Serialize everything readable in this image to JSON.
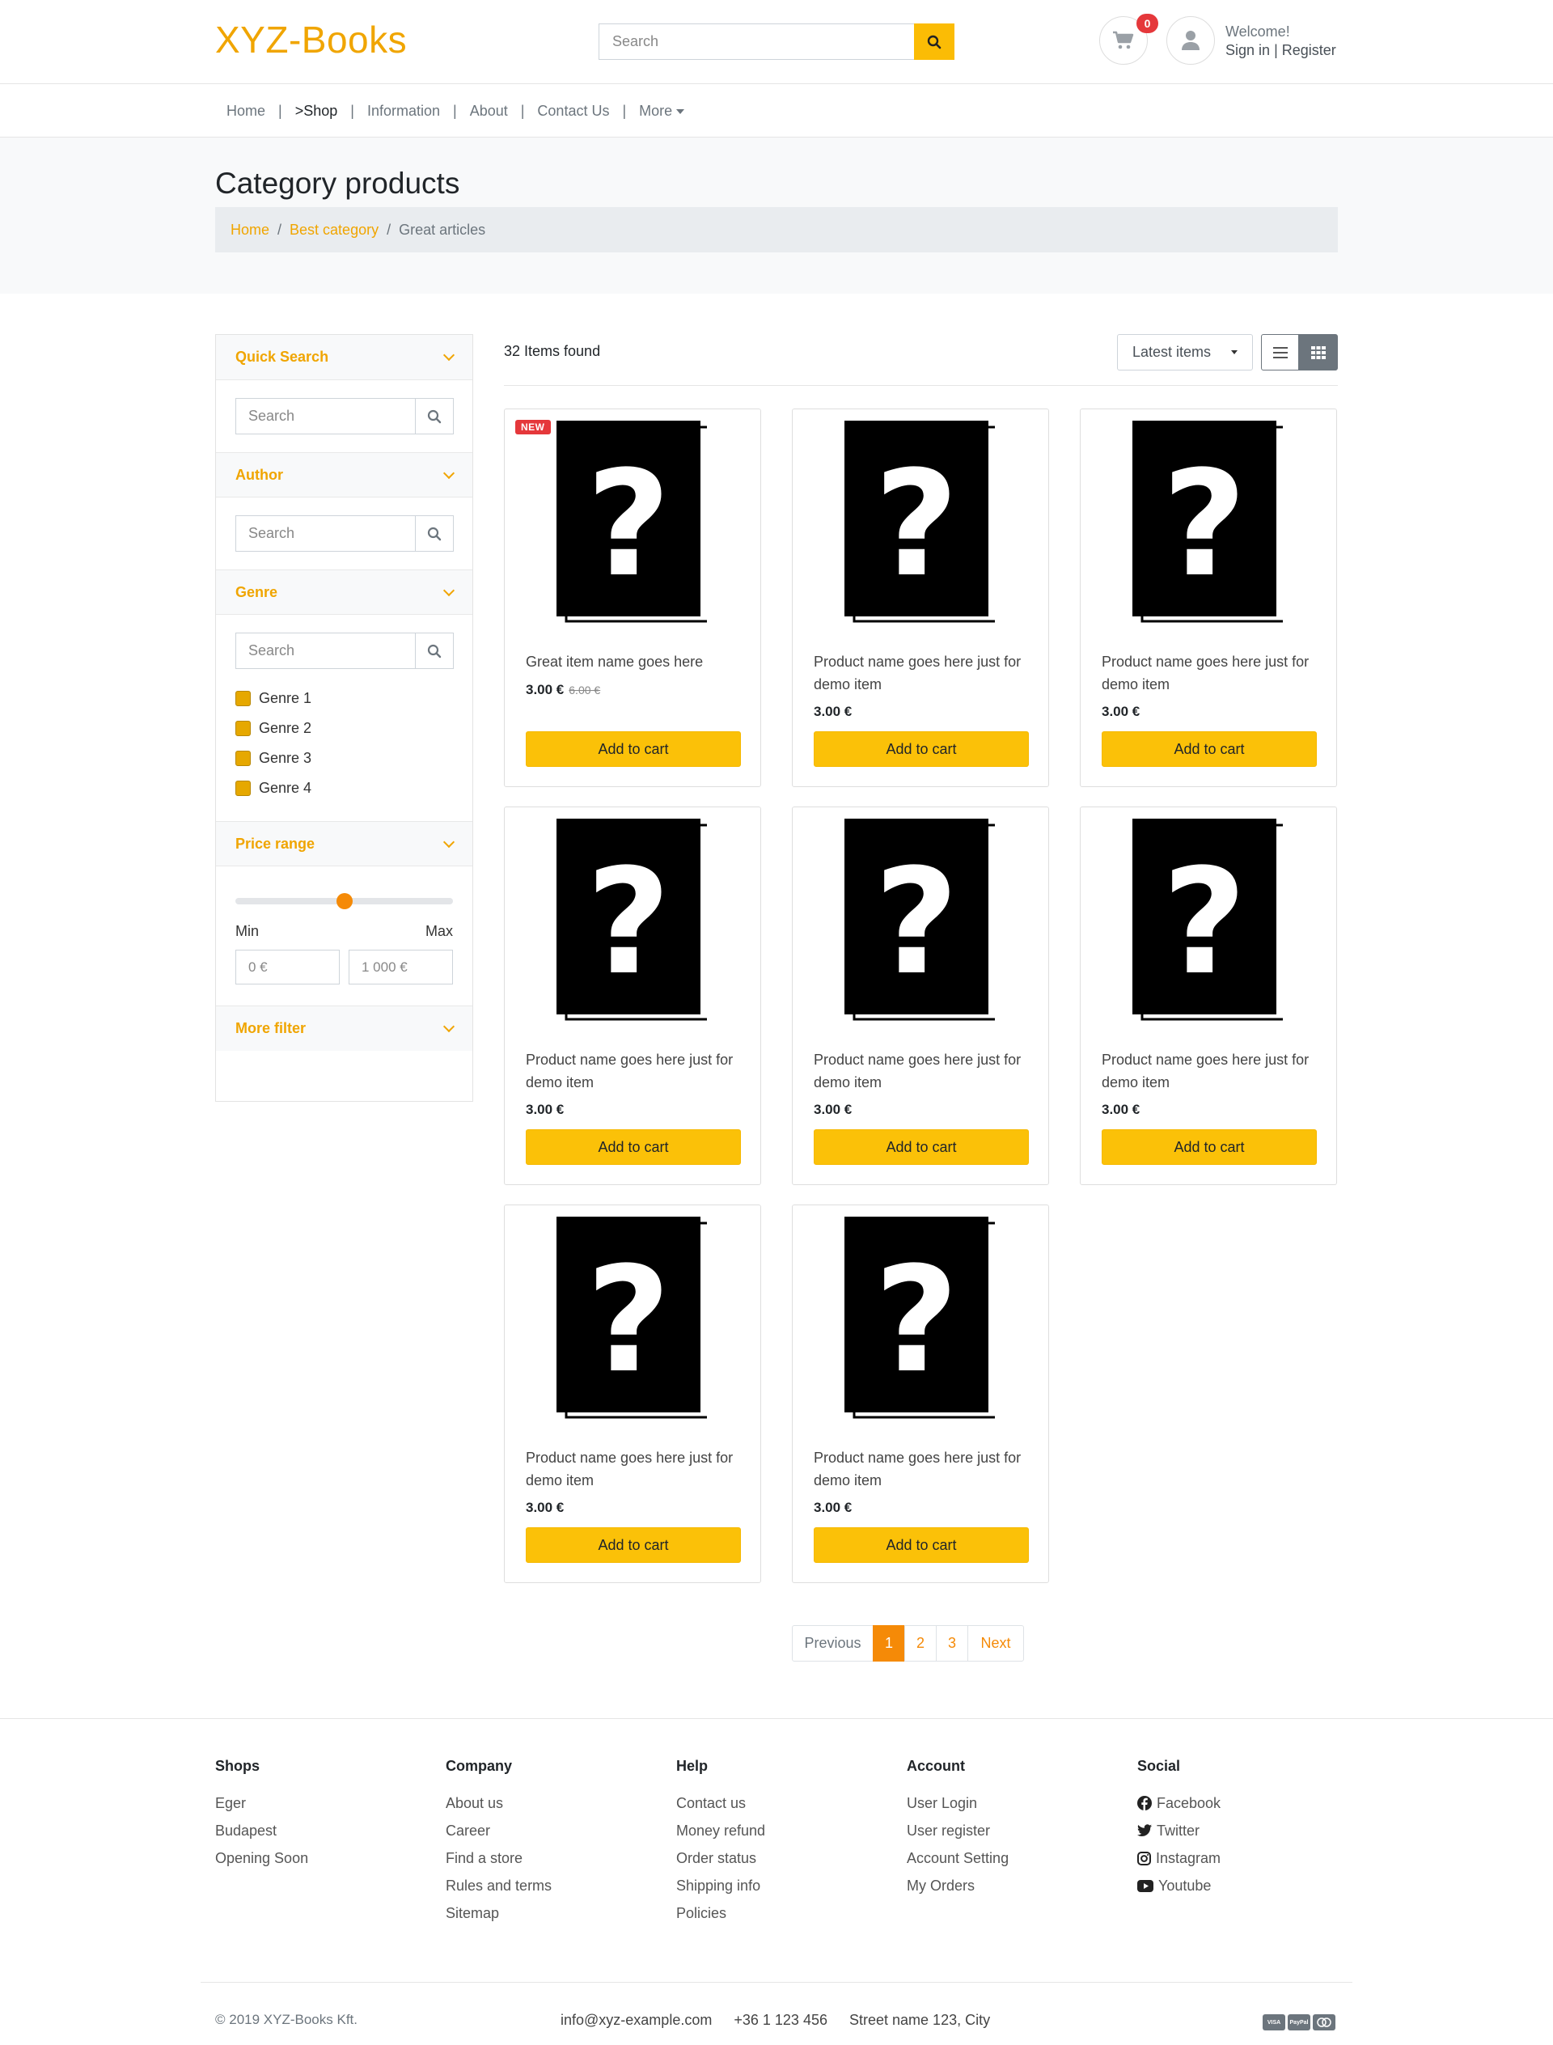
{
  "header": {
    "logo": "XYZ-Books",
    "search_placeholder": "Search",
    "cart_count": "0",
    "welcome": "Welcome!",
    "sign_in": "Sign in",
    "divider": "|",
    "register": "Register"
  },
  "nav": {
    "items": [
      "Home",
      ">Shop",
      "Information",
      "About",
      "Contact Us",
      "More"
    ],
    "separator": "|"
  },
  "page": {
    "title": "Category products",
    "breadcrumb": [
      "Home",
      "Best category",
      "Great articles"
    ],
    "breadcrumb_separator": "/"
  },
  "sidebar": {
    "quick_search": {
      "title": "Quick Search",
      "placeholder": "Search"
    },
    "author": {
      "title": "Author",
      "placeholder": "Search"
    },
    "genre": {
      "title": "Genre",
      "placeholder": "Search",
      "options": [
        "Genre 1",
        "Genre 2",
        "Genre 3",
        "Genre 4"
      ]
    },
    "price_range": {
      "title": "Price range",
      "min_label": "Min",
      "max_label": "Max",
      "min_placeholder": "0 €",
      "max_placeholder": "1 000 €",
      "slider_fraction": 0.5
    },
    "more_filter": {
      "title": "More filter"
    }
  },
  "toolbar": {
    "items_found": "32 Items found",
    "sort_selected": "Latest items"
  },
  "products": [
    {
      "name": "Great item name goes here",
      "price": "3.00 €",
      "old_price": "6.00 €",
      "badge": "NEW",
      "button": "Add to cart"
    },
    {
      "name": "Product name goes here just for demo item",
      "price": "3.00 €",
      "button": "Add to cart"
    },
    {
      "name": "Product name goes here just for demo item",
      "price": "3.00 €",
      "button": "Add to cart"
    },
    {
      "name": "Product name goes here just for demo item",
      "price": "3.00 €",
      "button": "Add to cart"
    },
    {
      "name": "Product name goes here just for demo item",
      "price": "3.00 €",
      "button": "Add to cart"
    },
    {
      "name": "Product name goes here just for demo item",
      "price": "3.00 €",
      "button": "Add to cart"
    },
    {
      "name": "Product name goes here just for demo item",
      "price": "3.00 €",
      "button": "Add to cart"
    },
    {
      "name": "Product name goes here just for demo item",
      "price": "3.00 €",
      "button": "Add to cart"
    }
  ],
  "pagination": {
    "previous": "Previous",
    "pages": [
      "1",
      "2",
      "3"
    ],
    "current": "1",
    "next": "Next"
  },
  "footer": {
    "columns": [
      {
        "title": "Shops",
        "links": [
          "Eger",
          "Budapest",
          "Opening Soon"
        ]
      },
      {
        "title": "Company",
        "links": [
          "About us",
          "Career",
          "Find a store",
          "Rules and terms",
          "Sitemap"
        ]
      },
      {
        "title": "Help",
        "links": [
          "Contact us",
          "Money refund",
          "Order status",
          "Shipping info",
          "Policies"
        ]
      },
      {
        "title": "Account",
        "links": [
          "User Login",
          "User register",
          "Account Setting",
          "My Orders"
        ]
      }
    ],
    "social": {
      "title": "Social",
      "links": [
        {
          "label": "Facebook",
          "icon": "facebook-icon"
        },
        {
          "label": "Twitter",
          "icon": "twitter-icon"
        },
        {
          "label": "Instagram",
          "icon": "instagram-icon"
        },
        {
          "label": "Youtube",
          "icon": "youtube-icon"
        }
      ]
    },
    "copyright": "© 2019 XYZ-Books Kft.",
    "email": "info@xyz-example.com",
    "phone": "+36 1 123 456",
    "address": "Street name 123, City",
    "payment_icons": [
      "VISA",
      "PayPal",
      "MC"
    ]
  },
  "colors": {
    "accent": "#f0a500",
    "button": "#fbc108",
    "active_page": "#f58a07",
    "badge": "#e5383b"
  }
}
